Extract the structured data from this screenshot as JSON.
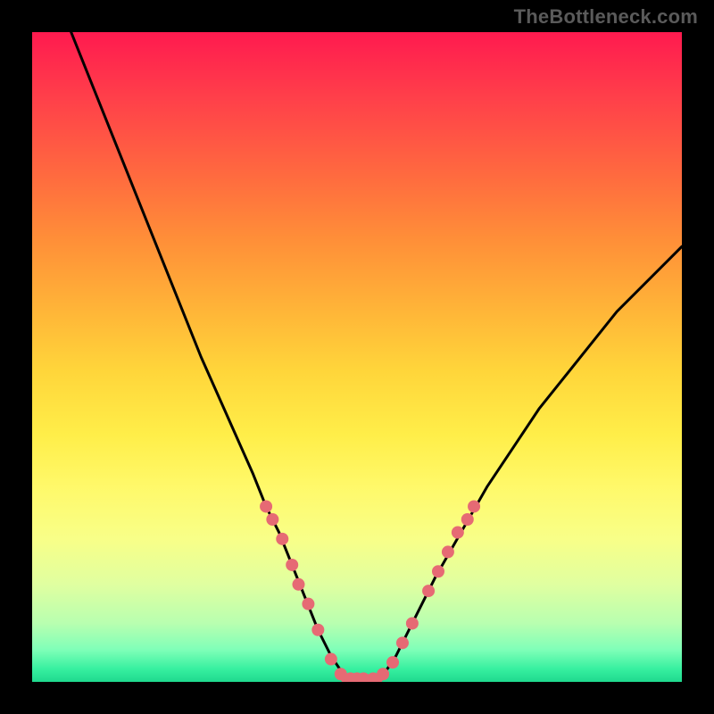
{
  "branding": "TheBottleneck.com",
  "chart_data": {
    "type": "line",
    "title": "",
    "xlabel": "",
    "ylabel": "",
    "xlim": [
      0,
      100
    ],
    "ylim": [
      0,
      100
    ],
    "curve": {
      "name": "bottleneck-curve",
      "x": [
        6,
        10,
        14,
        18,
        22,
        26,
        30,
        34,
        36,
        38,
        40,
        42,
        44,
        46,
        48,
        50,
        52,
        54,
        56,
        58,
        62,
        66,
        70,
        74,
        78,
        82,
        86,
        90,
        94,
        98,
        100
      ],
      "y": [
        100,
        90,
        80,
        70,
        60,
        50,
        41,
        32,
        27,
        23,
        18,
        13,
        8,
        4,
        1,
        0,
        0,
        1,
        4,
        8,
        16,
        23,
        30,
        36,
        42,
        47,
        52,
        57,
        61,
        65,
        67
      ]
    },
    "dot_clusters": [
      {
        "x": 36.0,
        "y": 27.0
      },
      {
        "x": 37.0,
        "y": 25.0
      },
      {
        "x": 38.5,
        "y": 22.0
      },
      {
        "x": 40.0,
        "y": 18.0
      },
      {
        "x": 41.0,
        "y": 15.0
      },
      {
        "x": 42.5,
        "y": 12.0
      },
      {
        "x": 44.0,
        "y": 8.0
      },
      {
        "x": 46.0,
        "y": 3.5
      },
      {
        "x": 47.5,
        "y": 1.2
      },
      {
        "x": 49.0,
        "y": 0.5
      },
      {
        "x": 50.0,
        "y": 0.5
      },
      {
        "x": 51.0,
        "y": 0.5
      },
      {
        "x": 52.5,
        "y": 0.5
      },
      {
        "x": 54.0,
        "y": 1.2
      },
      {
        "x": 55.5,
        "y": 3.0
      },
      {
        "x": 57.0,
        "y": 6.0
      },
      {
        "x": 58.5,
        "y": 9.0
      },
      {
        "x": 61.0,
        "y": 14.0
      },
      {
        "x": 62.5,
        "y": 17.0
      },
      {
        "x": 64.0,
        "y": 20.0
      },
      {
        "x": 65.5,
        "y": 23.0
      },
      {
        "x": 67.0,
        "y": 25.0
      },
      {
        "x": 68.0,
        "y": 27.0
      }
    ],
    "flat_segment": {
      "x": [
        47.5,
        54.0
      ],
      "y": 0.5
    },
    "colors": {
      "curve": "#000000",
      "dots": "#e66a74",
      "segment": "#e66a74"
    }
  }
}
